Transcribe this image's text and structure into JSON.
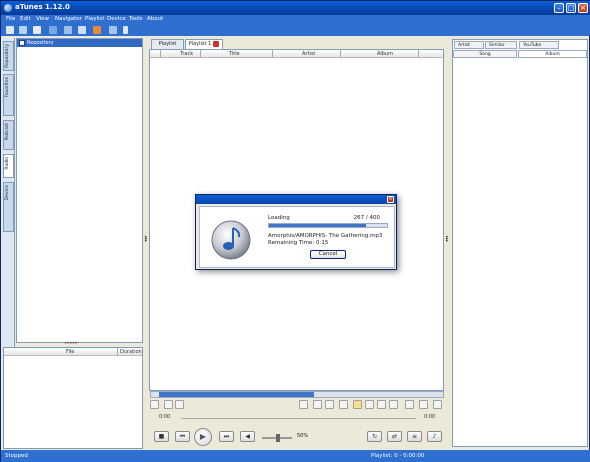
{
  "window": {
    "title": "aTunes 1.12.0"
  },
  "menu": [
    "File",
    "Edit",
    "View",
    "Navigator",
    "Playlist",
    "Device",
    "Tools",
    "About"
  ],
  "side_tabs": [
    "Repository",
    "Favorites",
    "Podcast",
    "Radio",
    "Device"
  ],
  "navigator": {
    "root_label": "Repository"
  },
  "left_list": {
    "col_file": "File",
    "col_duration": "Duration"
  },
  "center_tabs": [
    {
      "label": "Playlist"
    },
    {
      "label": "Playlist 1"
    }
  ],
  "playlist": {
    "col_track": "Track",
    "col_title": "Title",
    "col_artist": "Artist",
    "col_album": "Album"
  },
  "player": {
    "time_left": "0:00",
    "time_right": "0:00",
    "volume": "50%",
    "progress": 0.0,
    "volume_level": 0.5
  },
  "context_panel": {
    "tabs": [
      "Artist",
      "Similar",
      "YouTube"
    ],
    "subtabs": [
      "Song",
      "Album"
    ]
  },
  "status": {
    "left": "Stopped",
    "right": "Playlist: 0 - 0:00:00"
  },
  "dialog": {
    "label": "Loading",
    "count": "267 / 400",
    "progress": 0.82,
    "message": "Amorphis/AMORPHIS- The Gathering.mp3",
    "remaining": "Remaining Time:  0:15",
    "cancel_label": "Cancel"
  },
  "colors": {
    "accent": "#2f6fd0",
    "titlebar": "#0846b0",
    "progress": "#3f74c9"
  }
}
